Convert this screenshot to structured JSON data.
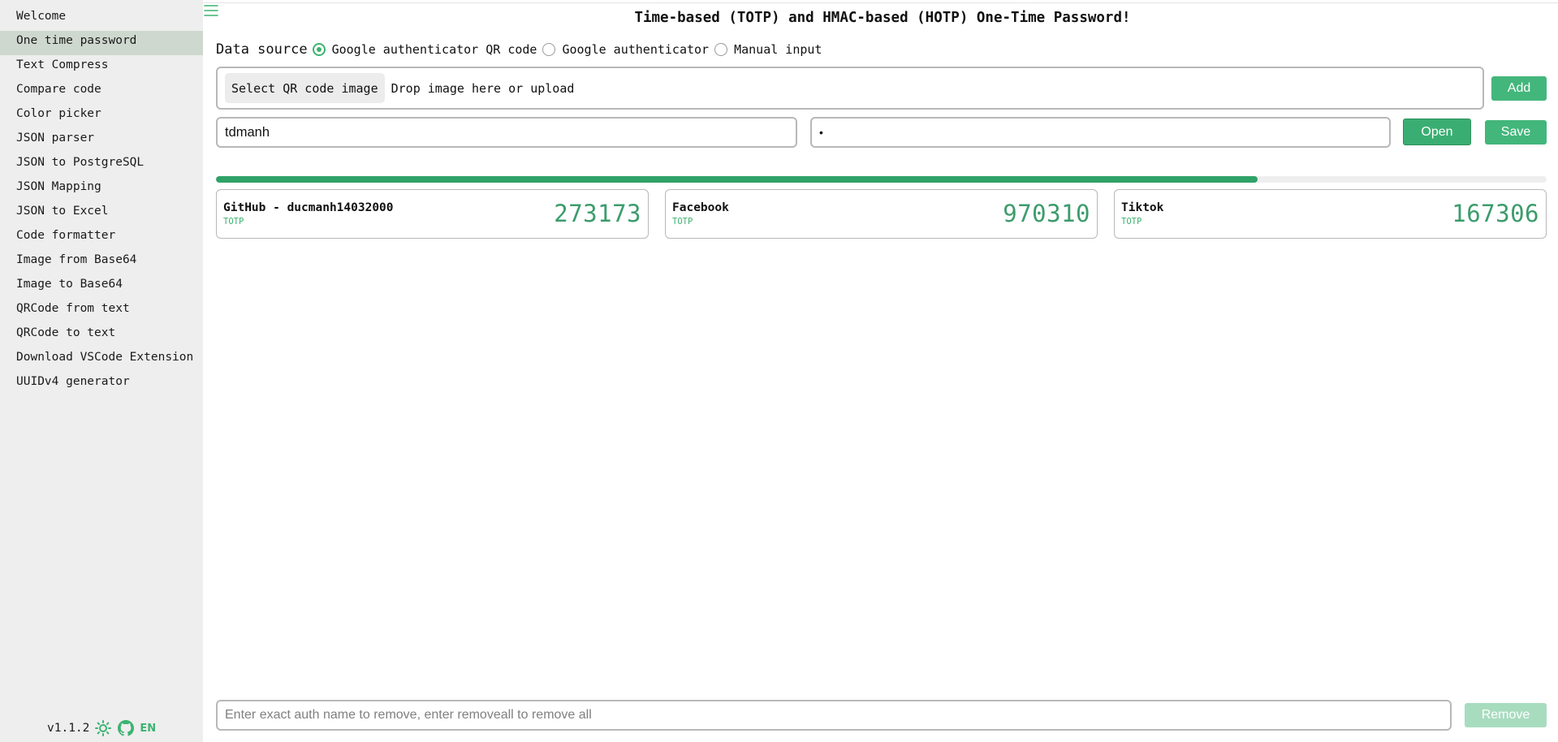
{
  "sidebar": {
    "items": [
      {
        "label": "Welcome",
        "active": false
      },
      {
        "label": "One time password",
        "active": true
      },
      {
        "label": "Text Compress",
        "active": false
      },
      {
        "label": "Compare code",
        "active": false
      },
      {
        "label": "Color picker",
        "active": false
      },
      {
        "label": "JSON parser",
        "active": false
      },
      {
        "label": "JSON to PostgreSQL",
        "active": false
      },
      {
        "label": "JSON Mapping",
        "active": false
      },
      {
        "label": "JSON to Excel",
        "active": false
      },
      {
        "label": "Code formatter",
        "active": false
      },
      {
        "label": "Image from Base64",
        "active": false
      },
      {
        "label": "Image to Base64",
        "active": false
      },
      {
        "label": "QRCode from text",
        "active": false
      },
      {
        "label": "QRCode to text",
        "active": false
      },
      {
        "label": "Download VSCode Extension",
        "active": false
      },
      {
        "label": "UUIDv4 generator",
        "active": false
      }
    ],
    "footer": {
      "version": "v1.1.2",
      "theme_icon": "sun-icon",
      "repo_icon": "github-icon",
      "language": "EN"
    }
  },
  "main": {
    "title": "Time-based (TOTP) and HMAC-based (HOTP) One-Time Password!",
    "data_source": {
      "label": "Data source",
      "options": [
        "Google authenticator QR code",
        "Google authenticator",
        "Manual input"
      ],
      "selected": "Google authenticator QR code"
    },
    "upload": {
      "button_label": "Select QR code image",
      "hint": "Drop image here or upload"
    },
    "add_label": "Add",
    "username_value": "tdmanh",
    "password_value": "•",
    "open_label": "Open",
    "save_label": "Save",
    "progress_fraction": 0.783,
    "accounts": [
      {
        "name": "GitHub - ducmanh14032000",
        "type": "TOTP",
        "code": "273173"
      },
      {
        "name": "Facebook",
        "type": "TOTP",
        "code": "970310"
      },
      {
        "name": "Tiktok",
        "type": "TOTP",
        "code": "167306"
      }
    ],
    "remove": {
      "placeholder": "Enter exact auth name to remove, enter removeall to remove all",
      "button_label": "Remove"
    }
  },
  "colors": {
    "accent": "#3cb371",
    "button": "#43b67b",
    "button_disabled": "#a8dcbf",
    "progress": "#2fa268",
    "active_nav": "#cfd8cf",
    "sidebar_bg": "#eeeeee"
  }
}
